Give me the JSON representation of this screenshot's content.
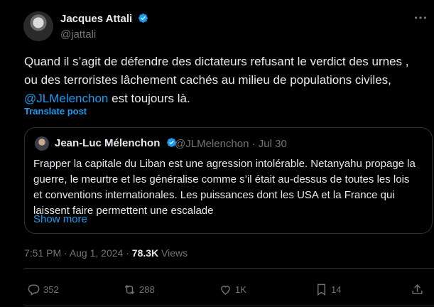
{
  "post": {
    "author_name": "Jacques Attali",
    "author_handle": "@jattali",
    "text_part1": "Quand il s’agit de défendre des dictateurs refusant le verdict des urnes , ou des terroristes lâchement cachés au milieu de populations civiles,",
    "mention": "@JLMelenchon",
    "text_part2": " est toujours là.",
    "translate_label": "Translate post",
    "time": "7:51 PM",
    "date": "Aug 1, 2024",
    "views_count": "78.3K",
    "views_label": "Views"
  },
  "quote": {
    "author_name": "Jean-Luc Mélenchon",
    "author_handle": "@JLMelenchon",
    "date": "Jul 30",
    "text": "Frapper la capitale du Liban est une agression intolérable. Netanyahu propage la guerre, le meurtre et les généralise comme s’il était au-dessus de toutes les lois et conventions internationales. Les puissances dont les USA et la France qui laissent faire permettent une escalade",
    "show_more": "Show more"
  },
  "actions": {
    "replies": "352",
    "reposts": "288",
    "likes": "1K",
    "bookmarks": "14"
  },
  "icons": {
    "verified": "verified-badge-icon",
    "more": "more-options-icon",
    "reply": "reply-icon",
    "repost": "repost-icon",
    "like": "heart-icon",
    "bookmark": "bookmark-icon",
    "share": "share-icon"
  },
  "colors": {
    "accent": "#1d9bf0",
    "text": "#e7e9ea",
    "muted": "#71767b",
    "background": "#000000"
  }
}
